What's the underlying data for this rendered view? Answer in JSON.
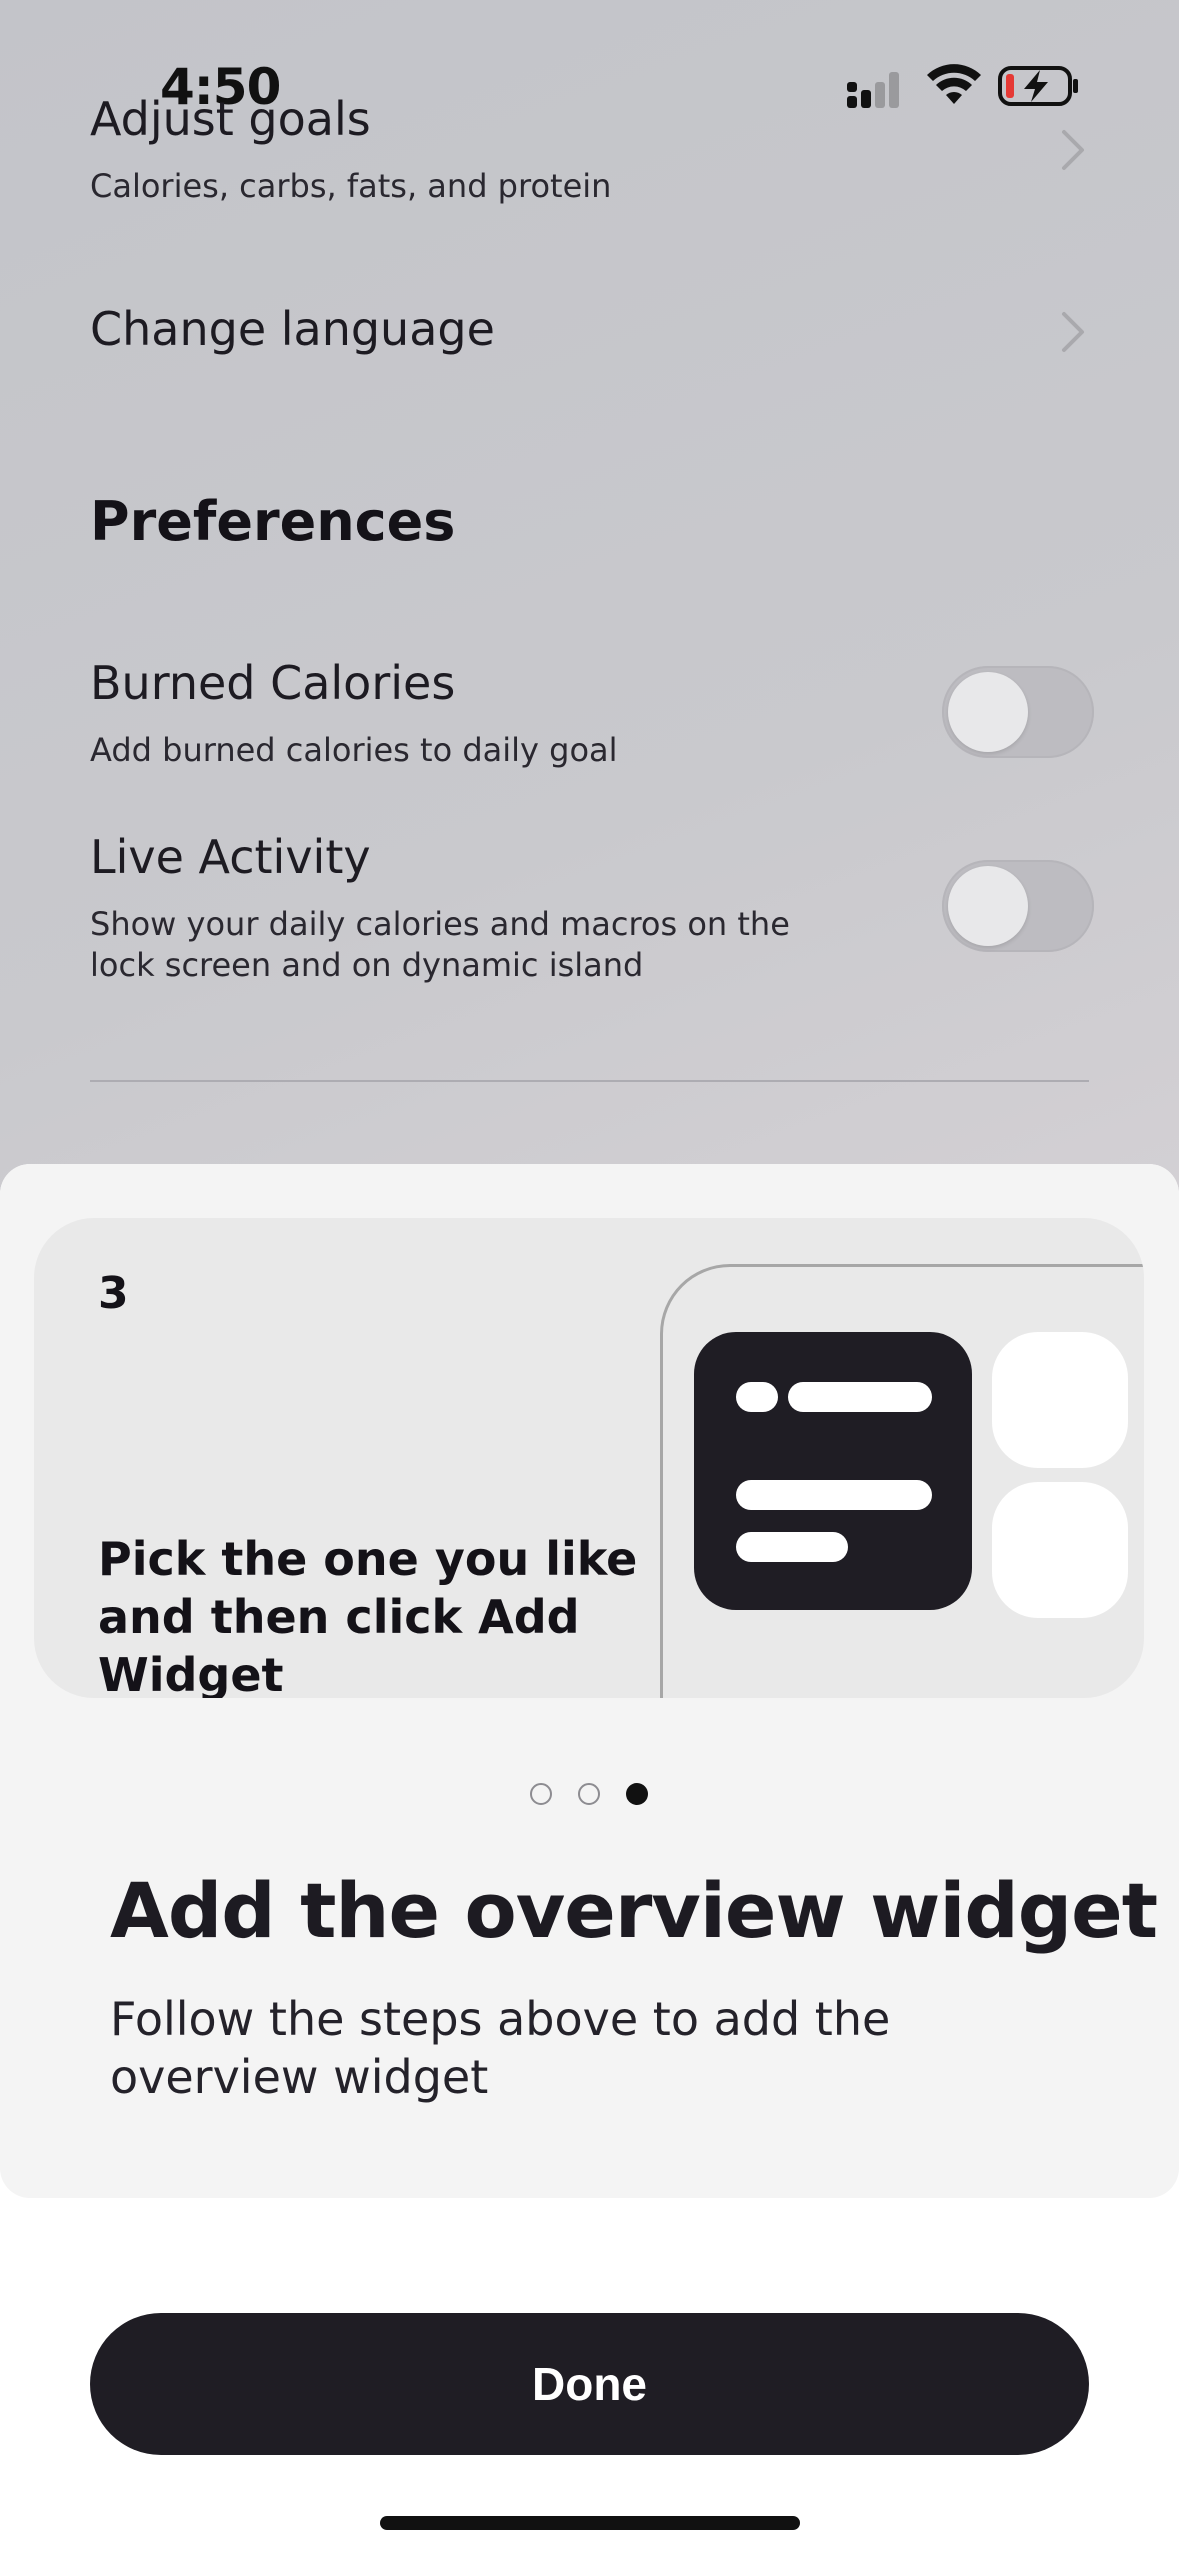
{
  "status_bar": {
    "time": "4:50",
    "icons": [
      "cellular-signal-icon",
      "wifi-icon",
      "battery-charging-icon"
    ]
  },
  "settings": {
    "adjust_goals": {
      "title": "Adjust goals",
      "subtitle": "Calories, carbs, fats, and protein"
    },
    "change_language": {
      "title": "Change language"
    },
    "preferences_heading": "Preferences",
    "burned_calories": {
      "title": "Burned Calories",
      "subtitle": "Add burned calories to daily goal",
      "enabled": false
    },
    "live_activity": {
      "title": "Live Activity",
      "subtitle_line1": "Show your daily calories and macros on the",
      "subtitle_line2": "lock screen and on dynamic island",
      "enabled": false
    }
  },
  "sheet": {
    "step": {
      "number": "3",
      "text_line1": "Pick the one you like",
      "text_line2": "and then click Add",
      "text_line3": "Widget"
    },
    "pagination": {
      "count": 3,
      "active_index": 2
    },
    "title": "Add the overview widget",
    "subtitle_line1": "Follow the steps above to add the",
    "subtitle_line2": "overview widget",
    "done_label": "Done"
  },
  "colors": {
    "primary_dark": "#1f1d24",
    "sheet_panel": "#f4f4f4",
    "battery_low": "#e53935"
  }
}
